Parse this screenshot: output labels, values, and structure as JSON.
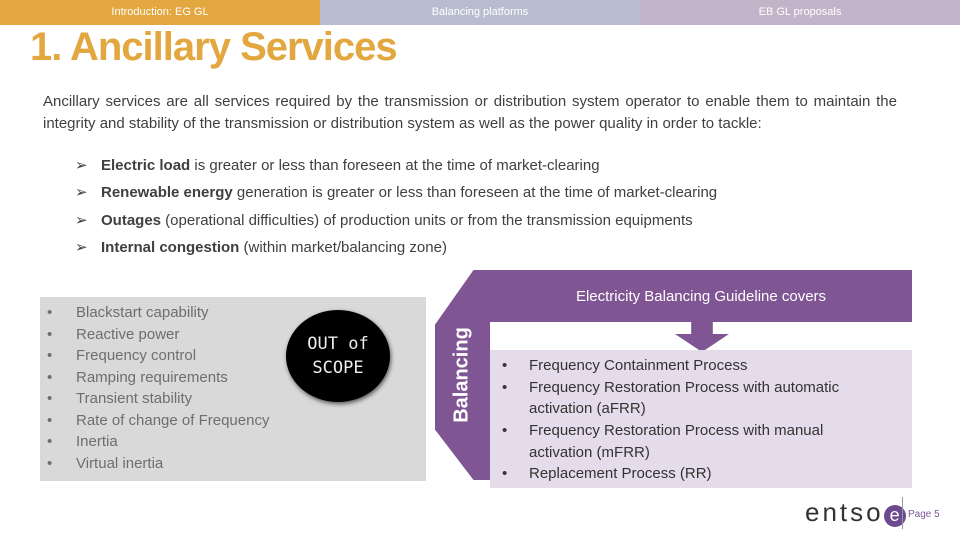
{
  "tabs": [
    "Introduction: EG GL",
    "Balancing platforms",
    "EB GL proposals"
  ],
  "colors": {
    "orange": "#e2a73f",
    "purple": "#7f5593",
    "lavender": "#e4dcea"
  },
  "title": "1. Ancillary Services",
  "intro": "Ancillary services are all services required by the transmission or distribution system operator to enable them to maintain the integrity and stability of the transmission or distribution system as well as the power quality in order to tackle:",
  "bullets": [
    {
      "bold": "Electric load",
      "rest": " is greater or less than foreseen at the time of market-clearing"
    },
    {
      "bold": "Renewable energy",
      "rest": " generation is greater or less than foreseen at the time of market-clearing"
    },
    {
      "bold": "Outages",
      "rest": " (operational difficulties) of production units or from the transmission equipments"
    },
    {
      "bold": "Internal congestion",
      "rest": " (within market/balancing zone)"
    }
  ],
  "out_of_scope": {
    "items": [
      "Blackstart capability",
      "Reactive power",
      "Frequency control",
      "Ramping requirements",
      "Transient stability",
      "Rate of change of Frequency",
      "Inertia",
      "Virtual inertia"
    ],
    "badge_line1": "OUT of",
    "badge_line2": "SCOPE"
  },
  "balancing": {
    "label": "Balancing",
    "header": "Electricity Balancing Guideline covers",
    "items": [
      "Frequency Containment Process",
      "Frequency Restoration Process with automatic activation (aFRR)",
      "Frequency Restoration Process with manual activation (mFRR)",
      "Replacement Process (RR)"
    ]
  },
  "footer": {
    "logo": "entsoe",
    "page": "Page 5"
  }
}
